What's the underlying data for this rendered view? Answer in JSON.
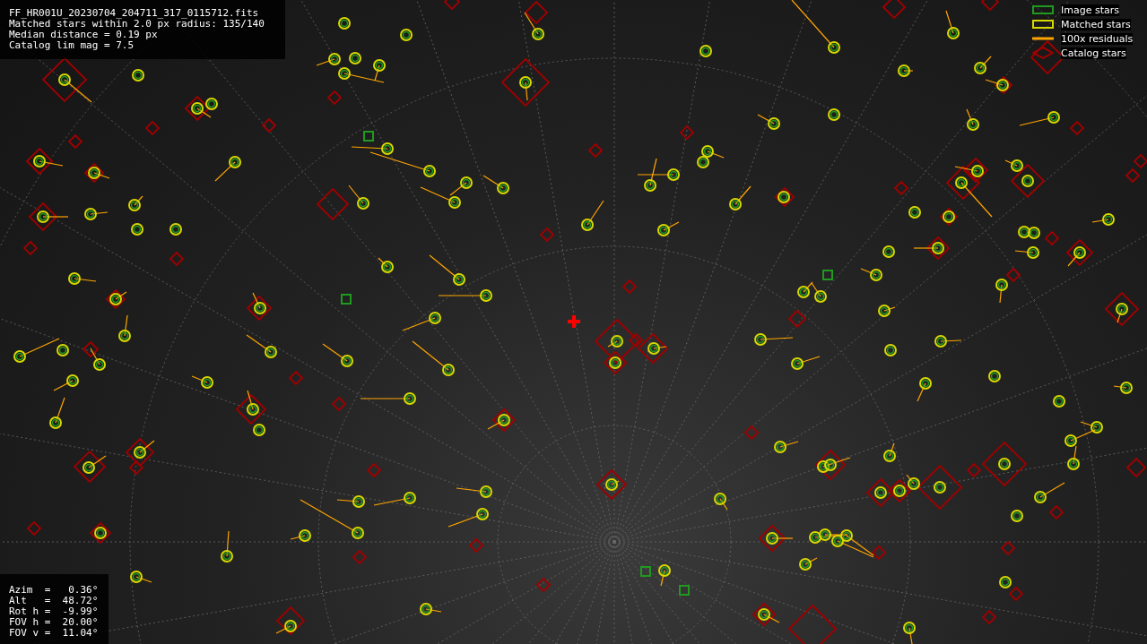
{
  "header_info": [
    "FF_HR001U_20230704_204711_317_0115712.fits",
    "Matched stars within 2.0 px radius: 135/140",
    "Median distance = 0.19 px",
    "Catalog lim mag = 7.5"
  ],
  "legend": [
    {
      "label": "Image stars",
      "kind": "square",
      "color": "#1f9a1f"
    },
    {
      "label": "Matched stars",
      "kind": "square",
      "color": "#d8d800"
    },
    {
      "label": "100x residuals",
      "kind": "line",
      "color": "#ffa500"
    },
    {
      "label": "Catalog stars",
      "kind": "diamond",
      "color": "#a00000"
    }
  ],
  "pointing": [
    "Azim  =   0.36°",
    "Alt   =  48.72°",
    "Rot h =  -9.99°",
    "FOV h =  20.00°",
    "FOV v =  11.04°"
  ]
}
